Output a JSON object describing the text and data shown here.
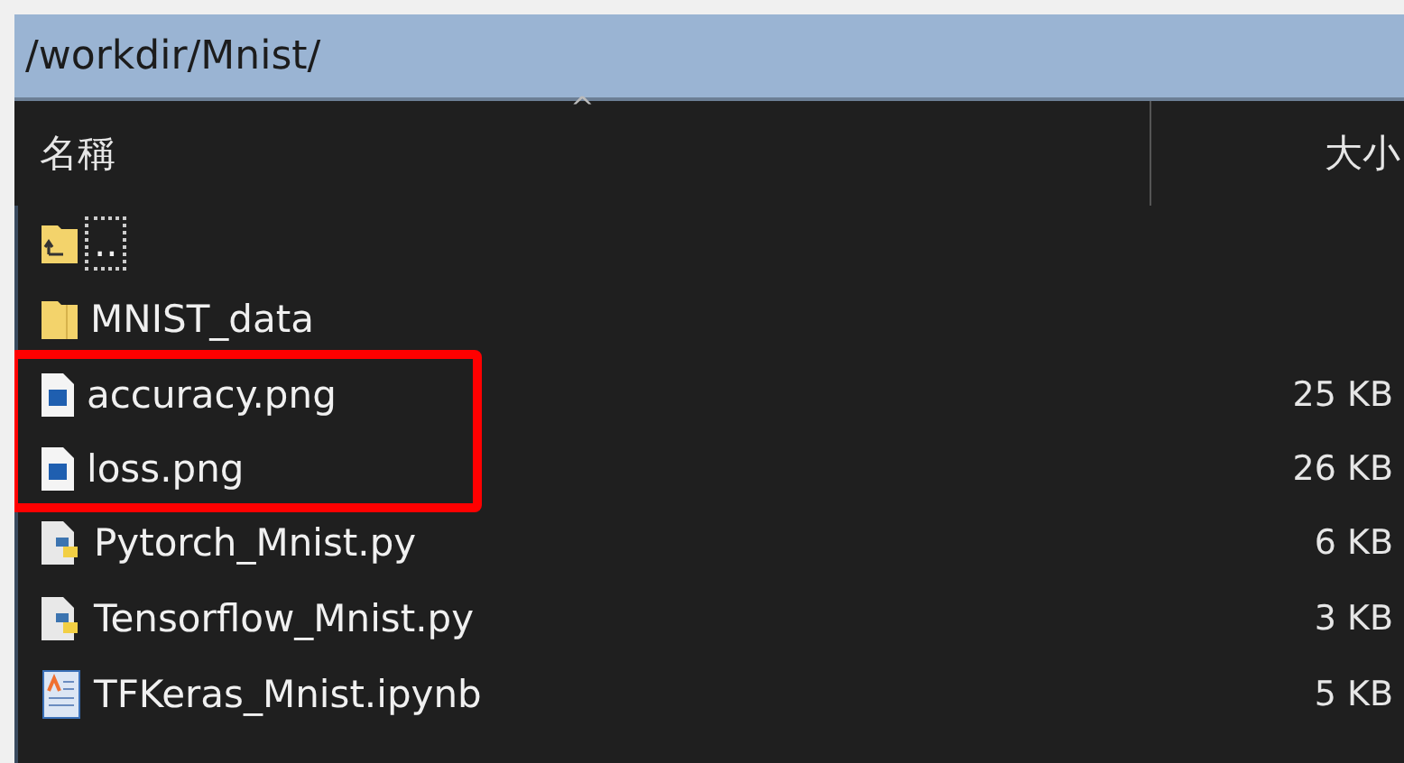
{
  "path_bar": {
    "path": "/workdir/Mnist/"
  },
  "columns": [
    {
      "label": "名稱",
      "sorted": true,
      "sort_glyph": "^"
    },
    {
      "label": "大小"
    }
  ],
  "rows": [
    {
      "kind": "parent",
      "name": "..",
      "focused": true,
      "highlighted": false
    },
    {
      "kind": "folder",
      "name": "MNIST_data",
      "focused": false,
      "highlighted": false
    },
    {
      "kind": "image",
      "name": "accuracy.png",
      "size": "25 KB",
      "focused": false,
      "highlighted": true
    },
    {
      "kind": "image",
      "name": "loss.png",
      "size": "26 KB",
      "focused": false,
      "highlighted": true
    },
    {
      "kind": "python",
      "name": "Pytorch_Mnist.py",
      "size": "6 KB",
      "focused": false,
      "highlighted": false
    },
    {
      "kind": "python",
      "name": "Tensorflow_Mnist.py",
      "size": "3 KB",
      "focused": false,
      "highlighted": false
    },
    {
      "kind": "notebook",
      "name": "TFKeras_Mnist.ipynb",
      "size": "5 KB",
      "focused": false,
      "highlighted": false
    }
  ]
}
